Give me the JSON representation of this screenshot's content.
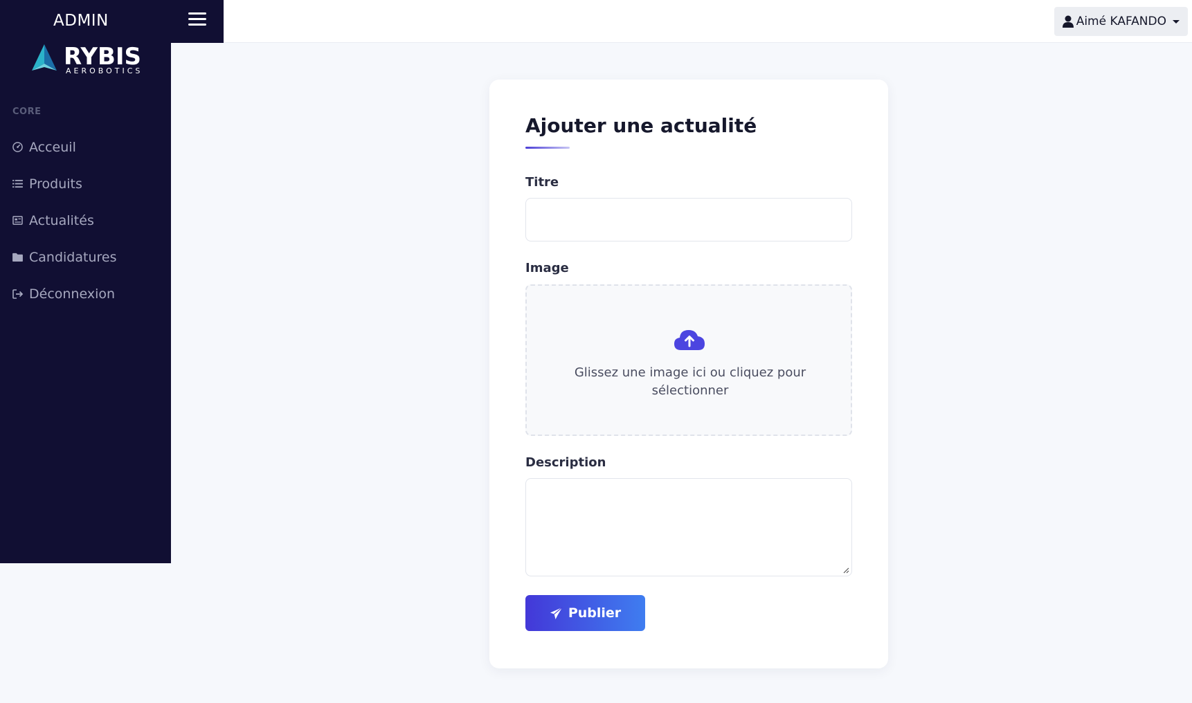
{
  "header": {
    "brand": "ADMIN",
    "user_name": "Aimé KAFANDO"
  },
  "sidebar": {
    "logo_word": "RYBIS",
    "logo_sub": "AEROBOTICS",
    "section": "CORE",
    "items": [
      {
        "label": "Acceuil",
        "icon": "dashboard-icon"
      },
      {
        "label": "Produits",
        "icon": "list-icon"
      },
      {
        "label": "Actualités",
        "icon": "newspaper-icon"
      },
      {
        "label": "Candidatures",
        "icon": "folder-icon"
      },
      {
        "label": "Déconnexion",
        "icon": "logout-icon"
      }
    ]
  },
  "form": {
    "title": "Ajouter une actualité",
    "title_label": "Titre",
    "title_value": "",
    "image_label": "Image",
    "dropzone_text": "Glissez une image ici ou cliquez pour sélectionner",
    "description_label": "Description",
    "description_value": "",
    "submit_label": "Publier"
  },
  "colors": {
    "sidebar_bg": "#110f33",
    "accent": "#4338d8",
    "accent_end": "#3f7df0",
    "page_bg": "#f6f8fc"
  }
}
